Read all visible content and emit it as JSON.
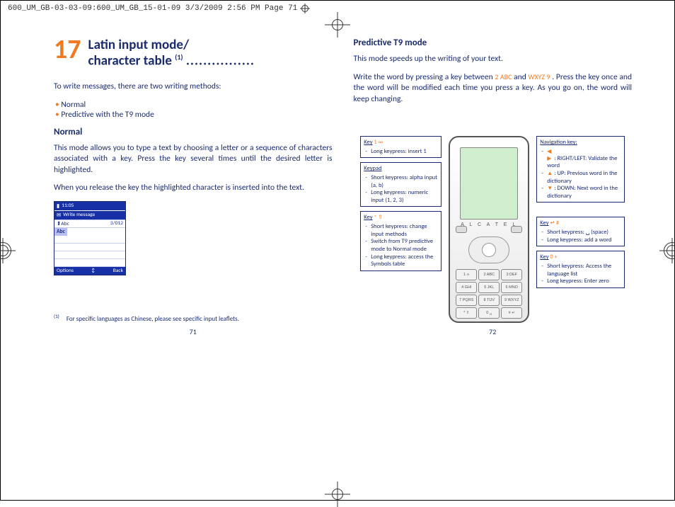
{
  "header_strip": "600_UM_GB-03-03-09:600_UM_GB_15-01-09  3/3/2009  2:56 PM  Page 71",
  "chapter": {
    "num": "17",
    "title_line1": "Latin input mode/",
    "title_line2": "character table",
    "title_sup": "(1)",
    "title_dots": "................"
  },
  "left": {
    "intro": "To write messages, there are two writing methods:",
    "bullets": [
      "Normal",
      "Predictive with the T9 mode"
    ],
    "normal_h": "Normal",
    "normal_p1": "This mode allows you to type a text by choosing a letter or a sequence of characters associated with a key. Press the key several times until the desired letter is highlighted.",
    "normal_p2": "When you release the key the highlighted character is inserted into the text.",
    "msgbox": {
      "time": "11:05",
      "title_icon": "✉",
      "title": "Write message",
      "mode": "⬆Abc",
      "counter": "3/012",
      "abc": "Abc",
      "opt": "Options",
      "mid": "↕",
      "back": "Back"
    },
    "footnote_sup": "(1)",
    "footnote": "For specific languages as Chinese, please see specific input leaflets.",
    "pagenum": "71"
  },
  "right": {
    "t9_h": "Predictive T9 mode",
    "t9_p1": "This mode speeds up the writing of your text.",
    "t9_p2a": "Write the word by pressing a key between ",
    "t9_key_a": "2 ABC",
    "t9_p2b": " and ",
    "t9_key_b": "WXYZ 9",
    "t9_p2c": ". Press the key once and the word will be modified each time you press a key. As you go on, the word will keep changing.",
    "phone_brand": "A L C A T E L",
    "keys": [
      "1 ∞",
      "2 ABC",
      "3 DEF",
      "4 GHI",
      "5 JKL",
      "6 MNO",
      "7 PQRS",
      "8 TUV",
      "9 WXYZ",
      "* ⇧",
      "0 ␣",
      "# ↵"
    ],
    "left_callouts": [
      {
        "title": "Key",
        "sym": "1 ∞",
        "items": [
          "Long keypress: insert 1"
        ]
      },
      {
        "title": "Keypad",
        "sym": "",
        "items": [
          "Short keypress: alpha input (a, b)",
          "Long keypress: numeric input (1, 2, 3)"
        ]
      },
      {
        "title": "Key",
        "sym": "* ⇧",
        "items": [
          "Short keypress: change input methods",
          "Switch from T9 predictive mode to Normal mode",
          "Long keypress: access the Symbols table"
        ]
      }
    ],
    "right_callouts": [
      {
        "title": "Navigation key:",
        "nav": [
          {
            "arrow": "◀ ▶",
            "text": ": RIGHT/LEFT: Validate the word"
          },
          {
            "arrow": "▲",
            "text": ": UP: Previous word in the dictionary"
          },
          {
            "arrow": "▼",
            "text": ": DOWN: Next word in the dictionary"
          }
        ]
      },
      {
        "title": "Key",
        "sym": "↵ #",
        "items": [
          "Short keypress: ␣ (space)",
          "Long keypress: add a word"
        ]
      },
      {
        "title": "Key",
        "sym": "0 +",
        "items": [
          "Short keypress: Access the language list",
          "Long keypress: Enter zero"
        ]
      }
    ],
    "pagenum": "72"
  }
}
